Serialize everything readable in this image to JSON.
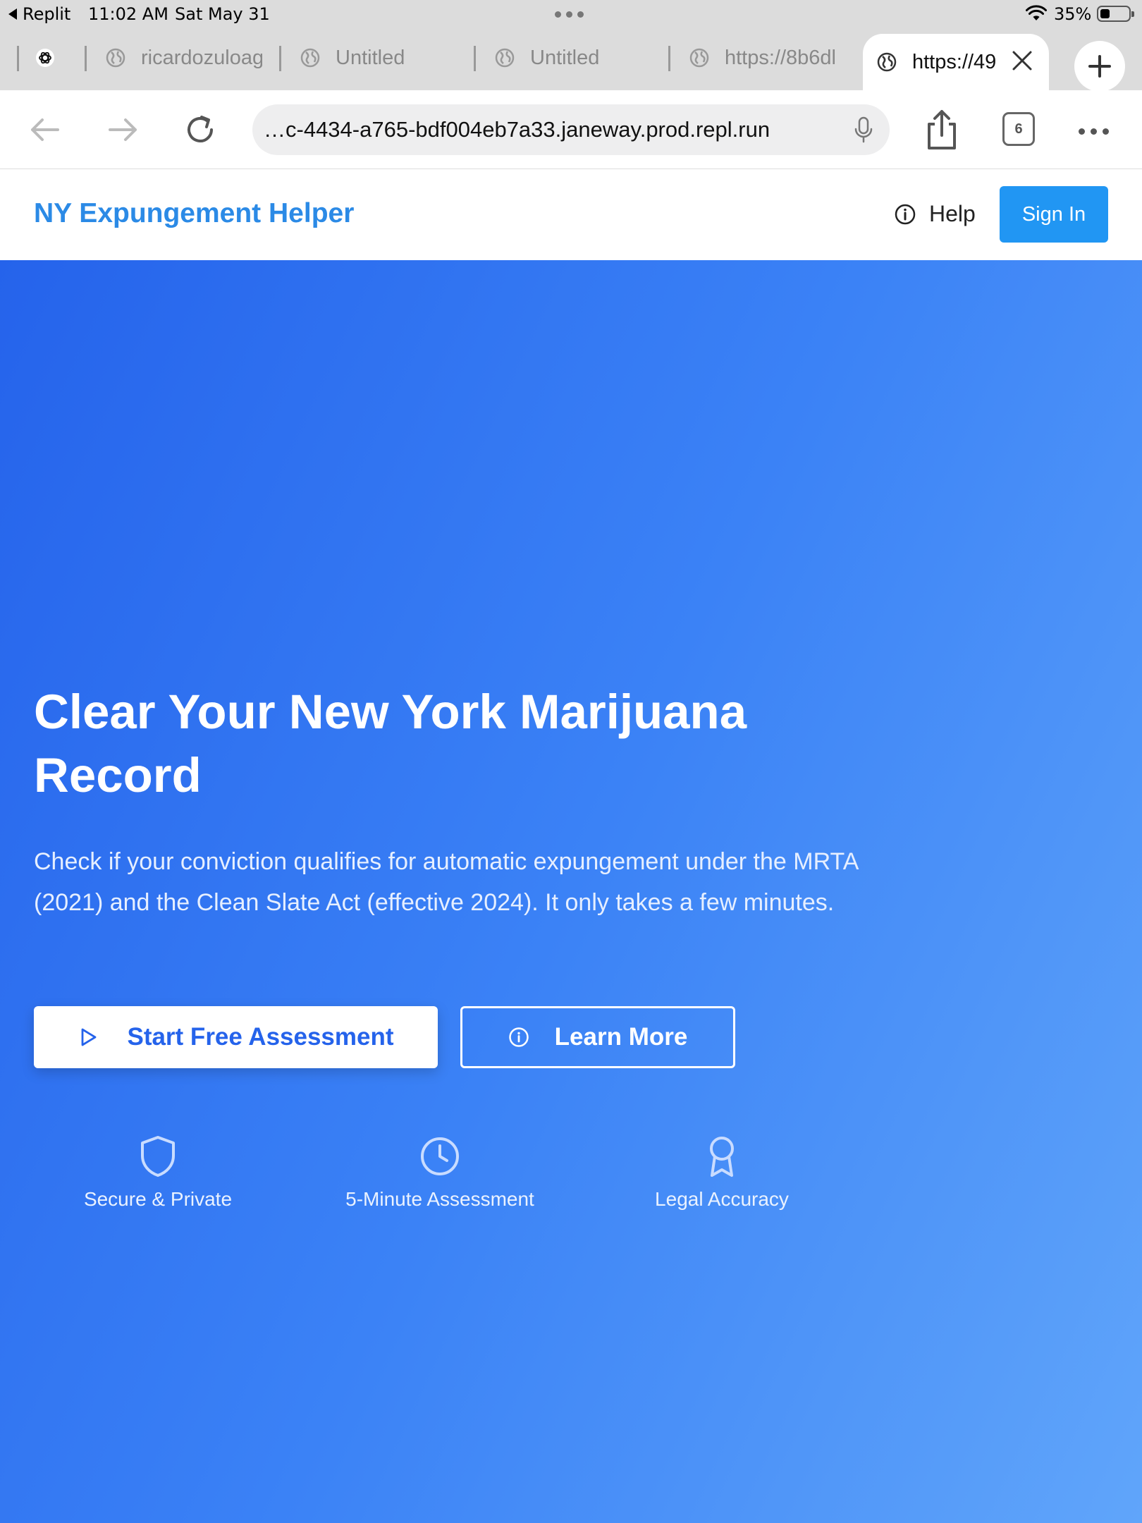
{
  "status_bar": {
    "back_app": "Replit",
    "time": "11:02 AM",
    "date": "Sat May 31",
    "battery_percent": "35%",
    "battery_level": 0.35
  },
  "tabs": [
    {
      "label": "",
      "icon": "chatgpt-icon"
    },
    {
      "label": "ricardozuloag",
      "icon": "globe-icon"
    },
    {
      "label": "Untitled",
      "icon": "globe-icon"
    },
    {
      "label": "Untitled",
      "icon": "globe-icon"
    },
    {
      "label": "https://8b6dl",
      "icon": "globe-icon"
    },
    {
      "label": "https://49",
      "icon": "globe-icon",
      "active": true
    }
  ],
  "address_bar": {
    "url": "…c-4434-a765-bdf004eb7a33.janeway.prod.repl.run",
    "tab_count": "6"
  },
  "site_header": {
    "brand": "NY Expungement Helper",
    "help_label": "Help",
    "sign_in_label": "Sign In"
  },
  "hero": {
    "title": "Clear Your New York Marijuana Record",
    "description": "Check if your conviction qualifies for automatic expungement under the MRTA (2021) and the Clean Slate Act (effective 2024). It only takes a few minutes.",
    "start_button": "Start Free Assessment",
    "learn_button": "Learn More",
    "features": [
      {
        "label": "Secure & Private",
        "icon": "shield-icon"
      },
      {
        "label": "5-Minute Assessment",
        "icon": "clock-icon"
      },
      {
        "label": "Legal Accuracy",
        "icon": "award-icon"
      }
    ]
  },
  "colors": {
    "brand_blue": "#2b8ae6",
    "sign_in_blue": "#2196f3",
    "hero_gradient_start": "#2563eb",
    "hero_gradient_end": "#60a5fa"
  }
}
